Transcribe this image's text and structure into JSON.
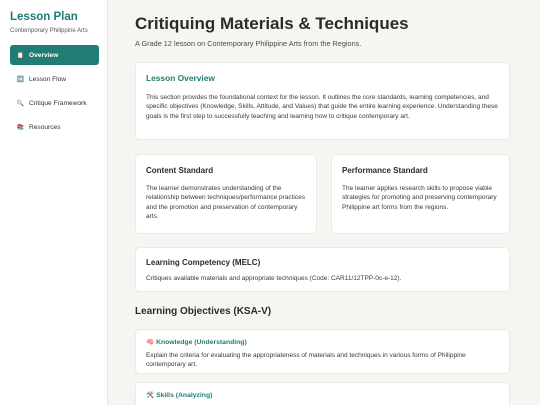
{
  "sidebar": {
    "title": "Lesson Plan",
    "subtitle": "Contemporary Philippine Arts",
    "items": [
      {
        "icon": "📋",
        "label": "Overview",
        "active": true
      },
      {
        "icon": "➡️",
        "label": "Lesson Flow",
        "active": false
      },
      {
        "icon": "🔍",
        "label": "Critique Framework",
        "active": false
      },
      {
        "icon": "📚",
        "label": "Resources",
        "active": false
      }
    ]
  },
  "header": {
    "title": "Critiquing Materials & Techniques",
    "subtitle": "A Grade 12 lesson on Contemporary Philippine Arts from the Regions."
  },
  "overview": {
    "title": "Lesson Overview",
    "text": "This section provides the foundational context for the lesson. It outlines the core standards, learning competencies, and specific objectives (Knowledge, Skills, Attitude, and Values) that guide the entire learning experience. Understanding these goals is the first step to successfully teaching and learning how to critique contemporary art."
  },
  "content_standard": {
    "title": "Content Standard",
    "text": "The learner demonstrates understanding of the relationship between techniques/performance practices and the promotion and preservation of contemporary arts."
  },
  "performance_standard": {
    "title": "Performance Standard",
    "text": "The learner applies research skills to propose viable strategies for promoting and preserving contemporary Philippine art forms from the regions."
  },
  "competency": {
    "title": "Learning Competency (MELC)",
    "text": "Critiques available materials and appropriate techniques (Code: CAR11/12TPP-0c-e-12)."
  },
  "objectives": {
    "title": "Learning Objectives (KSA-V)",
    "items": [
      {
        "icon": "🧠",
        "title": "Knowledge (Understanding)",
        "text": "Explain the criteria for evaluating the appropriateness of materials and techniques in various forms of Philippine contemporary art."
      },
      {
        "icon": "🛠️",
        "title": "Skills (Analyzing)",
        "text": ""
      }
    ]
  },
  "colors": {
    "accent": "#1f7d75",
    "background": "#f6f5f2"
  }
}
